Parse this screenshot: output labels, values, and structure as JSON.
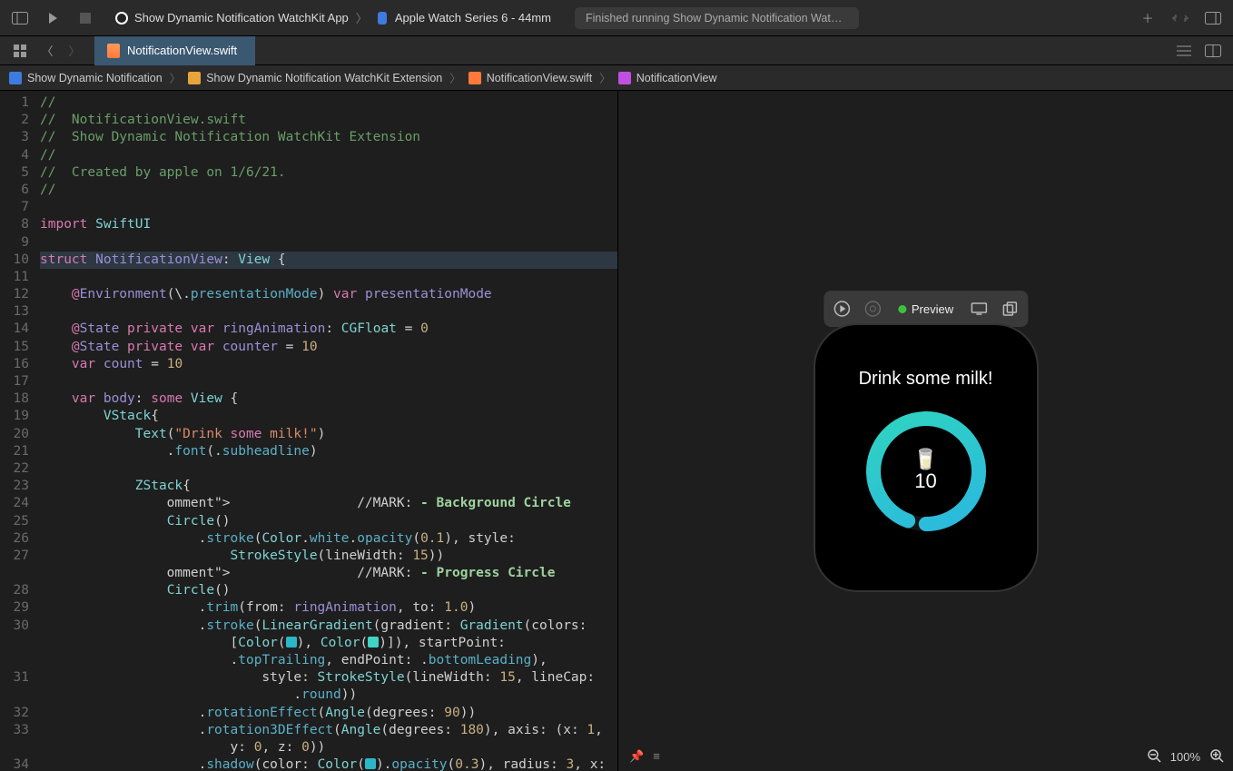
{
  "toolbar": {
    "scheme_app": "Show Dynamic Notification WatchKit App",
    "scheme_device": "Apple Watch Series 6 - 44mm",
    "status": "Finished running Show Dynamic Notification WatchKit App on Apple Watch Series 6 - 44.."
  },
  "tabs": {
    "active": "NotificationView.swift"
  },
  "breadcrumb": {
    "project": "Show Dynamic Notification",
    "folder": "Show Dynamic Notification WatchKit Extension",
    "file": "NotificationView.swift",
    "symbol": "NotificationView"
  },
  "code": {
    "lines": [
      "//",
      "//  NotificationView.swift",
      "//  Show Dynamic Notification WatchKit Extension",
      "//",
      "//  Created by apple on 1/6/21.",
      "//",
      "",
      "import SwiftUI",
      "",
      "struct NotificationView: View {",
      "",
      "    @Environment(\\.presentationMode) var presentationMode",
      "",
      "    @State private var ringAnimation: CGFloat = 0",
      "    @State private var counter = 10",
      "    var count = 10",
      "",
      "    var body: some View {",
      "        VStack{",
      "            Text(\"Drink some milk!\")",
      "                .font(.subheadline)",
      "",
      "            ZStack{",
      "                //MARK: - Background Circle",
      "                Circle()",
      "                    .stroke(Color.white.opacity(0.1), style:",
      "                        StrokeStyle(lineWidth: 15))",
      "                //MARK: - Progress Circle",
      "                Circle()",
      "                    .trim(from: ringAnimation, to: 1.0)",
      "                    .stroke(LinearGradient(gradient: Gradient(colors:",
      "                        [Color(■), Color(■)]), startPoint:",
      "                        .topTrailing, endPoint: .bottomLeading),",
      "                            style: StrokeStyle(lineWidth: 15, lineCap:",
      "                                .round))",
      "                    .rotationEffect(Angle(degrees: 90))",
      "                    .rotation3DEffect(Angle(degrees: 180), axis: (x: 1,",
      "                        y: 0, z: 0))",
      "                    .shadow(color: Color(■).opacity(0.3), radius: 3, x:"
    ],
    "highlighted_line": 10
  },
  "preview": {
    "label": "Preview",
    "watch_title": "Drink some milk!",
    "watch_count": "10",
    "milk_emoji": "🥛"
  },
  "zoom": {
    "level": "100%"
  }
}
